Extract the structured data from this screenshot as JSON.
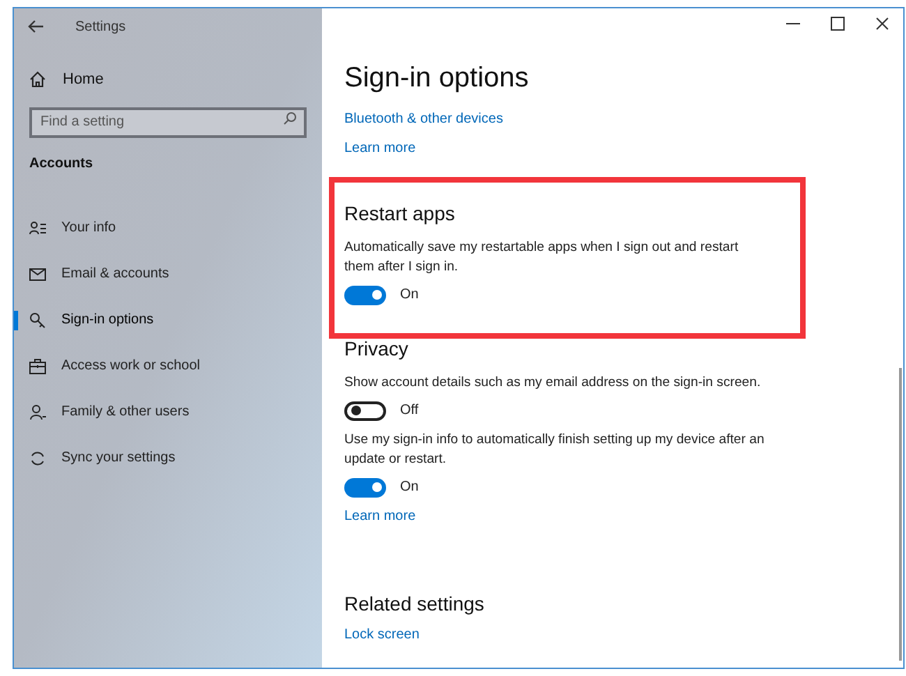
{
  "window": {
    "title": "Settings"
  },
  "sidebar": {
    "home": "Home",
    "search": {
      "placeholder": "Find a setting"
    },
    "heading": "Accounts",
    "items": [
      {
        "label": "Your info",
        "selected": false
      },
      {
        "label": "Email & accounts",
        "selected": false
      },
      {
        "label": "Sign-in options",
        "selected": true
      },
      {
        "label": "Access work or school",
        "selected": false
      },
      {
        "label": "Family & other users",
        "selected": false
      },
      {
        "label": "Sync your settings",
        "selected": false
      }
    ]
  },
  "page": {
    "title": "Sign-in options",
    "blocks": [
      {
        "kind": "link",
        "text": "Bluetooth & other devices"
      },
      {
        "kind": "link",
        "text": "Learn more"
      },
      {
        "kind": "highlight",
        "blocks": [
          {
            "kind": "heading",
            "text": "Restart apps"
          },
          {
            "kind": "text",
            "text": "Automatically save my restartable apps when I sign out and restart them after I sign in."
          },
          {
            "kind": "toggle",
            "on": true,
            "label": "On"
          }
        ]
      },
      {
        "kind": "heading",
        "text": "Privacy"
      },
      {
        "kind": "text",
        "text": "Show account details such as my email address on the sign-in screen."
      },
      {
        "kind": "toggle",
        "on": false,
        "label": "Off"
      },
      {
        "kind": "text",
        "text": "Use my sign-in info to automatically finish setting up my device after an update or restart."
      },
      {
        "kind": "toggle",
        "on": true,
        "label": "On"
      },
      {
        "kind": "link",
        "text": "Learn more"
      },
      {
        "kind": "heading",
        "text": "Related settings"
      },
      {
        "kind": "link",
        "text": "Lock screen"
      }
    ]
  }
}
